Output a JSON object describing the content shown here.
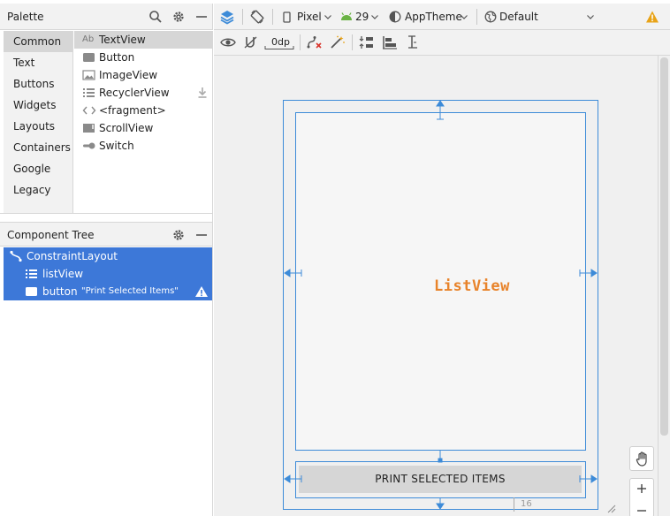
{
  "palette": {
    "title": "Palette",
    "categories": [
      "Common",
      "Text",
      "Buttons",
      "Widgets",
      "Layouts",
      "Containers",
      "Google",
      "Legacy"
    ],
    "selected_category": "Common",
    "widgets": [
      {
        "label": "TextView",
        "icon": "textview-icon",
        "selected": true
      },
      {
        "label": "Button",
        "icon": "button-icon"
      },
      {
        "label": "ImageView",
        "icon": "image-icon"
      },
      {
        "label": "RecyclerView",
        "icon": "list-icon",
        "download": true
      },
      {
        "label": "<fragment>",
        "icon": "code-icon"
      },
      {
        "label": "ScrollView",
        "icon": "scrollview-icon"
      },
      {
        "label": "Switch",
        "icon": "switch-icon"
      }
    ],
    "textview_icon_text": "Ab"
  },
  "component_tree": {
    "title": "Component Tree",
    "nodes": [
      {
        "label": "ConstraintLayout",
        "icon": "constraint-layout-icon"
      },
      {
        "label": "listView",
        "icon": "list-icon"
      },
      {
        "label": "button",
        "icon": "button-icon",
        "text": "\"Print Selected Items\"",
        "warning": true
      }
    ]
  },
  "toolbar": {
    "device": "Pixel",
    "api_level": "29",
    "theme": "AppTheme",
    "locale": "Default (en-us)",
    "default_margin": "0dp"
  },
  "canvas": {
    "listview_label": "ListView",
    "button_text": "PRINT SELECTED ITEMS",
    "margin_value": "16"
  },
  "colors": {
    "blueprint": "#3d8bd8",
    "selection": "#3d78d8",
    "listview_label": "#e8832a",
    "warning": "#e8a317"
  }
}
